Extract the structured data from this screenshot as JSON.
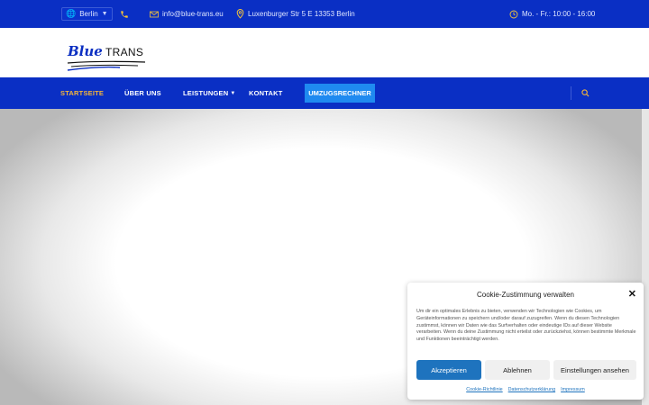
{
  "topbar": {
    "city": "Berlin",
    "email": "info@blue-trans.eu",
    "address": "Luxenburger Str 5 E 13353 Berlin",
    "hours": "Mo. - Fr.: 10:00 - 16:00"
  },
  "logo": {
    "word1": "Blue",
    "word2": "TRANS"
  },
  "nav": {
    "items": [
      "STARTSEITE",
      "ÜBER UNS",
      "LEISTUNGEN",
      "KONTAKT"
    ],
    "cta": "UMZUGSRECHNER"
  },
  "cookie": {
    "title": "Cookie-Zustimmung verwalten",
    "text": "Um dir ein optimales Erlebnis zu bieten, verwenden wir Technologien wie Cookies, um Geräteinformationen zu speichern und/oder darauf zuzugreifen. Wenn du diesen Technologien zustimmst, können wir Daten wie das Surfverhalten oder eindeutige IDs auf dieser Website verarbeiten. Wenn du deine Zustimmung nicht erteilst oder zurückziehst, können bestimmte Merkmale und Funktionen beeinträchtigt werden.",
    "accept": "Akzeptieren",
    "deny": "Ablehnen",
    "settings": "Einstellungen ansehen",
    "links": [
      "Cookie-Richtlinie",
      "Datenschutzerklärung",
      "Impressum"
    ]
  },
  "colors": {
    "brand_blue": "#0a2fc4",
    "accent_orange": "#f3b43a",
    "cta_blue": "#1f8af0",
    "accept_blue": "#1e73be"
  },
  "icons": {
    "city": "globe-icon",
    "phone": "phone-icon",
    "email": "envelope-icon",
    "address": "map-pin-icon",
    "hours": "clock-icon",
    "search": "search-icon",
    "close": "close-icon"
  }
}
